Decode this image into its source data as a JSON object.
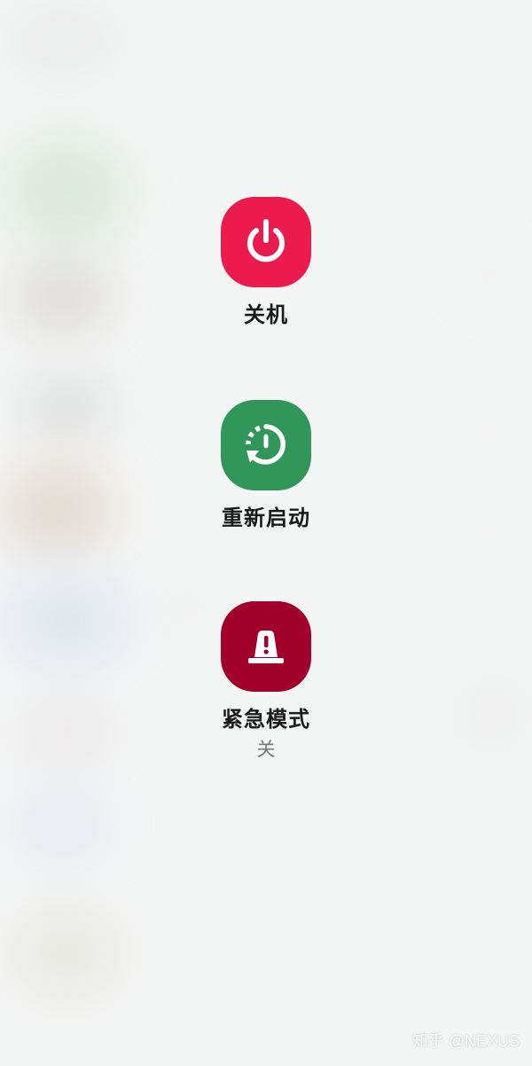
{
  "power_menu": {
    "options": [
      {
        "label": "关机",
        "icon": "power-icon",
        "color": "#ec1b4e"
      },
      {
        "label": "重新启动",
        "icon": "restart-icon",
        "color": "#30965a"
      },
      {
        "label": "紧急模式",
        "icon": "emergency-icon",
        "color": "#a0002a",
        "status": "关"
      }
    ]
  },
  "watermark": "知乎 @NEXUS"
}
